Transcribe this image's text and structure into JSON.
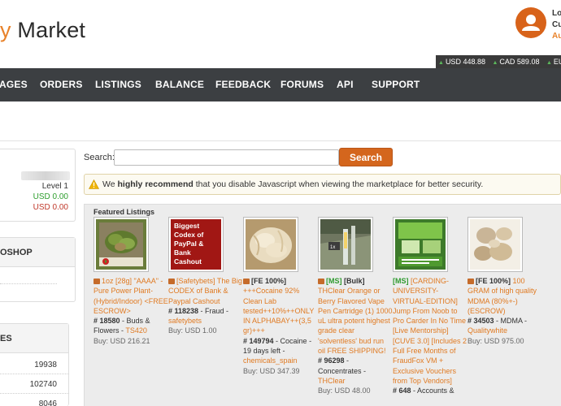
{
  "header": {
    "logo_accent": "y",
    "logo_main": "Market",
    "user_line1": "Lo",
    "user_line2": "Cu",
    "user_line3": "Au"
  },
  "prices": [
    {
      "label": "USD 448.88"
    },
    {
      "label": "CAD 589.08"
    },
    {
      "label": "EUR"
    }
  ],
  "nav": [
    "AGES",
    "ORDERS",
    "LISTINGS",
    "BALANCE",
    "FEEDBACK",
    "FORUMS",
    "API",
    "SUPPORT"
  ],
  "account": {
    "level": "Level 1",
    "usd_balance": "USD 0.00",
    "usd_pending": "USD 0.00"
  },
  "sidebar": {
    "shop_heading": "OSHOP",
    "categories_heading": "ES",
    "category_counts": [
      "19938",
      "102740",
      "8046"
    ]
  },
  "search": {
    "label": "Search:",
    "placeholder": "",
    "button": "Search"
  },
  "alert": {
    "prefix": "We ",
    "strong": "highly recommend",
    "suffix": " that you disable Javascript when viewing the marketplace for better security."
  },
  "featured": {
    "title": "Featured Listings",
    "items": [
      {
        "tag": "",
        "title": "1oz [28g] \"AAAA\" -Pure Power Plant- (Hybrid/Indoor) <FREE ESCROW>",
        "id": "# 18580",
        "category": " - Buds & Flowers - ",
        "vendor": "TS420",
        "price": "Buy: USD 216.21"
      },
      {
        "tag": "",
        "title": "[Safetybets] The Big CODEX of Bank & Paypal Cashout",
        "id": "# 118238",
        "category": " - Fraud - ",
        "vendor": "safetybets",
        "price": "Buy: USD 1.00"
      },
      {
        "tag": "[FE 100%]",
        "title": " +++Cocaine 92% Clean Lab tested++10%++ONLY IN ALPHABAY++(3,5 gr)+++",
        "id": "# 149794",
        "category": " - Cocaine - 19 days left - ",
        "vendor": "chemicals_spain",
        "price": "Buy: USD 347.39"
      },
      {
        "tag": "[MS]",
        "tag2": " [Bulk]",
        "title": " THClear Orange or Berry Flavored Vape Pen Cartridge (1) 1000 uL ultra potent highest grade clear 'solventless' bud run oil FREE SHIPPING!",
        "id": "# 96298",
        "category": " - Concentrates - ",
        "vendor": "THClear",
        "price": "Buy: USD 48.00"
      },
      {
        "tag": "[MS]",
        "title": " [CARDING-UNIVERSITY-VIRTUAL-EDITION] Jump From Noob to Pro Carder In No Time [Live Mentorship] [CUVE 3.0] [Includes 2 Full Free Months of FraudFox VM + Exclusive Vouchers from Top Vendors]",
        "id": "# 648",
        "category": " - Accounts &",
        "vendor": "",
        "price": ""
      },
      {
        "tag": "[FE 100%]",
        "title": " 100 GRAM of high quality MDMA (80%+-) (ESCROW)",
        "id": "# 34503",
        "category": " - MDMA - ",
        "vendor": "Qualitywhite",
        "price": "Buy: USD 975.00"
      }
    ]
  },
  "thumb_texts": {
    "codex": [
      "Biggest",
      "Codex of",
      "PayPal &",
      "Bank",
      "Cashout"
    ],
    "vape_label": "1x"
  }
}
